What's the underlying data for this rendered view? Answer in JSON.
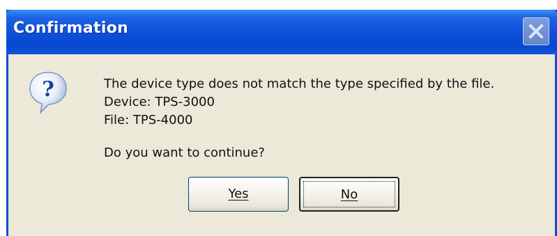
{
  "dialog": {
    "title": "Confirmation",
    "icon": "question-icon",
    "message_lines": [
      "The device type does not match the type specified by the file.",
      "Device: TPS-3000",
      "File: TPS-4000"
    ],
    "question": "Do you want to continue?",
    "buttons": {
      "yes_label": "Yes",
      "no_label": "No"
    },
    "default_button": "no"
  },
  "colors": {
    "titlebar": "#0b4fd8",
    "client_bg": "#ece9d8",
    "title_text": "#ffffff"
  }
}
